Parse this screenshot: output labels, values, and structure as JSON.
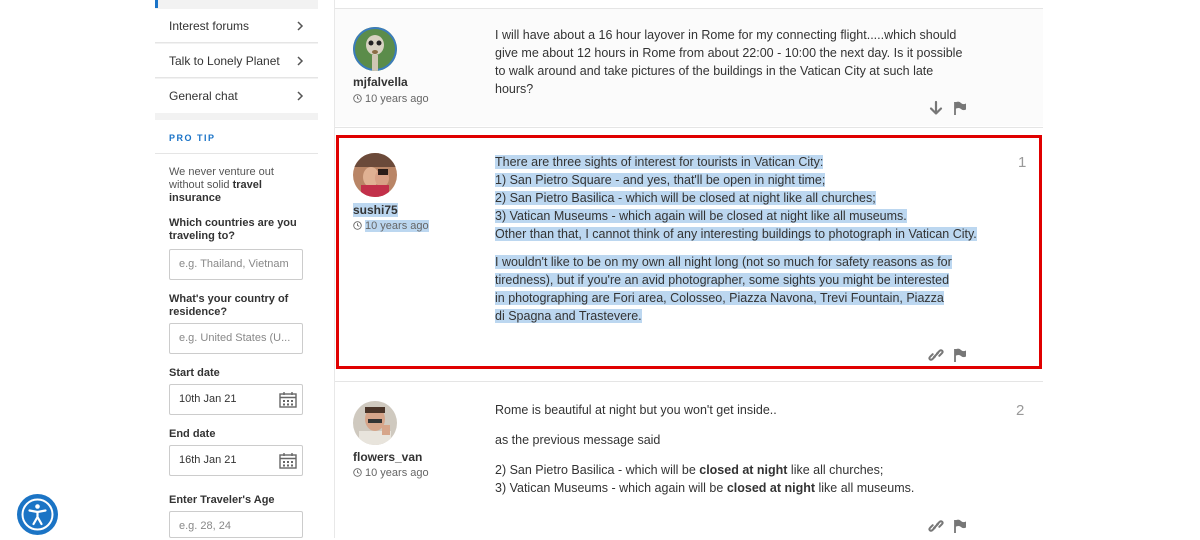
{
  "sidebar": {
    "nav_items": [
      {
        "label": "Interest forums"
      },
      {
        "label": "Talk to Lonely Planet"
      },
      {
        "label": "General chat"
      }
    ],
    "protip": {
      "title": "PRO TIP",
      "text_before": "We never venture out without solid ",
      "text_bold": "travel insurance",
      "form": {
        "countries_label": "Which countries are you traveling to?",
        "countries_placeholder": "e.g. Thailand, Vietnam",
        "residence_label": "What's your country of residence?",
        "residence_placeholder": "e.g. United States (U...",
        "start_label": "Start date",
        "start_value": "10th Jan 21",
        "end_label": "End date",
        "end_value": "16th Jan 21",
        "age_label": "Enter Traveler's Age",
        "age_placeholder": "e.g. 28, 24"
      }
    }
  },
  "posts": [
    {
      "author": "mjfalvella",
      "time": "10 years ago",
      "body": "I will have about a 16 hour layover in Rome for my connecting flight.....which should give me about 12 hours in Rome from about 22:00 - 10:00 the next day. Is it possible to walk around and take pictures of the buildings in the Vatican City at such late hours?"
    },
    {
      "author": "sushi75",
      "time": "10 years ago",
      "number": "1",
      "lines": [
        "There are three sights of interest for tourists in Vatican City:",
        "1) San Pietro Square - and yes, that'll be open in night time;",
        "2) San Pietro Basilica - which will be closed at night like all churches;",
        "3) Vatican Museums - which again will be closed at night like all museums.",
        "Other than that, I cannot think of any interesting buildings to photograph in Vatican City."
      ],
      "paragraph2": "I wouldn't like to be on my own all night long (not so much for safety reasons as for tiredness), but if you're an avid photographer, some sights you might be interested in photographing are Fori area, Colosseo, Piazza Navona, Trevi Fountain, Piazza di Spagna and Trastevere."
    },
    {
      "author": "flowers_van",
      "time": "10 years ago",
      "number": "2",
      "line1": "Rome is beautiful at night but you won't get inside..",
      "line2": "as the previous message said",
      "item2_a": "2) San Pietro Basilica - which will be ",
      "item2_b": "closed at night",
      "item2_c": " like all churches;",
      "item3_a": "3) Vatican Museums - which again will be ",
      "item3_b": "closed at night",
      "item3_c": " like all museums."
    }
  ],
  "icons": {
    "chevron": "chevron-right-icon",
    "clock": "clock-icon",
    "calendar": "calendar-icon",
    "flag": "flag-icon",
    "link": "link-icon",
    "downvote": "arrow-down-icon",
    "accessibility": "accessibility-icon"
  },
  "colors": {
    "accent": "#1a73c7",
    "highlight_box": "#e00000",
    "selection": "#bcd7f0"
  }
}
